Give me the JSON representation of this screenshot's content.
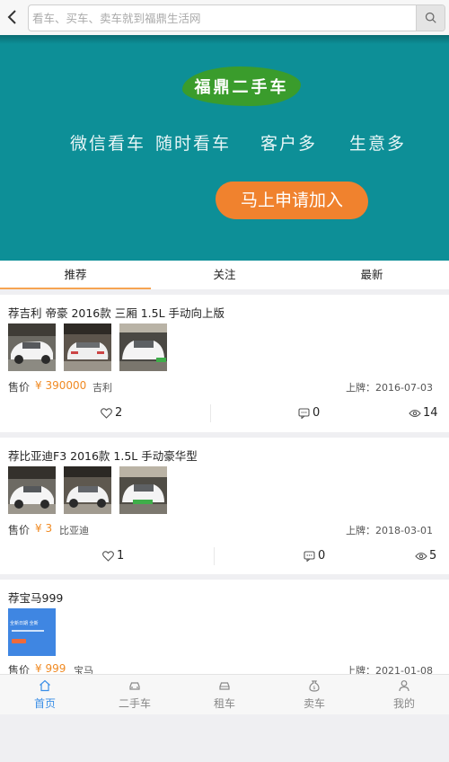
{
  "search": {
    "placeholder": "看车、买车、卖车就到福鼎生活网"
  },
  "banner": {
    "logo": "福鼎二手车",
    "slogans": [
      "微信看车",
      "随时看车",
      "客户多",
      "生意多"
    ],
    "join_label": "马上申请加入"
  },
  "tabs": [
    "推荐",
    "关注",
    "最新"
  ],
  "price_label": "售价",
  "listings": [
    {
      "title": "荐吉利 帝豪 2016款 三厢 1.5L 手动向上版",
      "price": "¥ 390000",
      "brand": "吉利",
      "reg": "上牌：2016-07-03",
      "likes": "2",
      "comments": "0",
      "views": "14"
    },
    {
      "title": "荐比亚迪F3 2016款 1.5L 手动豪华型",
      "price": "¥ 3",
      "brand": "比亚迪",
      "reg": "上牌：2018-03-01",
      "likes": "1",
      "comments": "0",
      "views": "5"
    },
    {
      "title": "荐宝马999",
      "price": "¥ 999",
      "brand": "宝马",
      "reg": "上牌：2021-01-08",
      "thumb_text": "全新日期 全新"
    }
  ],
  "nav": [
    {
      "label": "首页",
      "icon": "home-icon"
    },
    {
      "label": "二手车",
      "icon": "car-icon"
    },
    {
      "label": "租车",
      "icon": "rental-car-icon"
    },
    {
      "label": "卖车",
      "icon": "money-bag-icon"
    },
    {
      "label": "我的",
      "icon": "user-icon"
    }
  ],
  "colors": {
    "banner": "#0d8f97",
    "accent": "#f08a23",
    "active_nav": "#3a8ee6",
    "join": "#f0822e",
    "logo": "#3a9c2c"
  }
}
